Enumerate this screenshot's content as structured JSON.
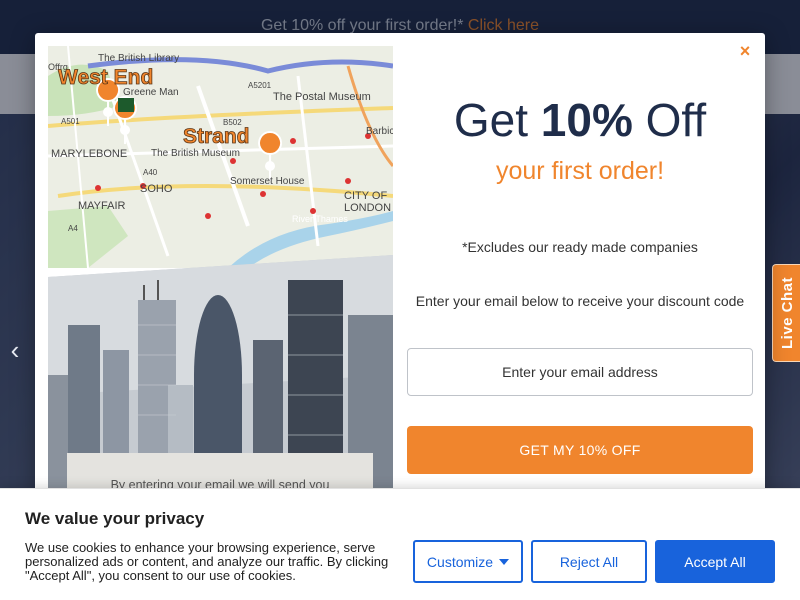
{
  "topbar": {
    "promo_text": "Get 10% off your first order!*",
    "promo_link": "Click here"
  },
  "slider": {
    "prev_icon": "chevron-left-icon",
    "prev_glyph": "‹"
  },
  "live_chat": {
    "label": "Live Chat"
  },
  "modal": {
    "close_glyph": "×",
    "map": {
      "labels": [
        "The British Library",
        "Greene Man",
        "The Postal Museum",
        "The British Museum",
        "Somerset House",
        "MARYLEBONE",
        "SOHO",
        "MAYFAIR",
        "CITY OF",
        "LONDON",
        "Barbic",
        "River Thames",
        "Offrg",
        "A501",
        "A5201",
        "A40",
        "B502",
        "A4"
      ],
      "area_west_end": "West End",
      "area_strand": "Strand"
    },
    "disclaimer": "By entering your email we will send you",
    "headline_prefix": "Get",
    "headline_bold": "10%",
    "headline_suffix": "Off",
    "subheadline": "your first order!",
    "excludes": "*Excludes our ready made companies",
    "instruction": "Enter your email below to receive your discount code",
    "email_placeholder": "Enter your email address",
    "cta_label": "GET MY 10% OFF"
  },
  "cookie": {
    "title": "We value your privacy",
    "text": "We use cookies to enhance your browsing experience, serve personalized ads or content, and analyze our traffic. By clicking \"Accept All\", you consent to our use of cookies.",
    "customize": "Customize",
    "reject": "Reject All",
    "accept": "Accept All"
  },
  "colors": {
    "brand_navy": "#1f2d4a",
    "accent_orange": "#f0852d",
    "cookie_blue": "#1863dc"
  }
}
